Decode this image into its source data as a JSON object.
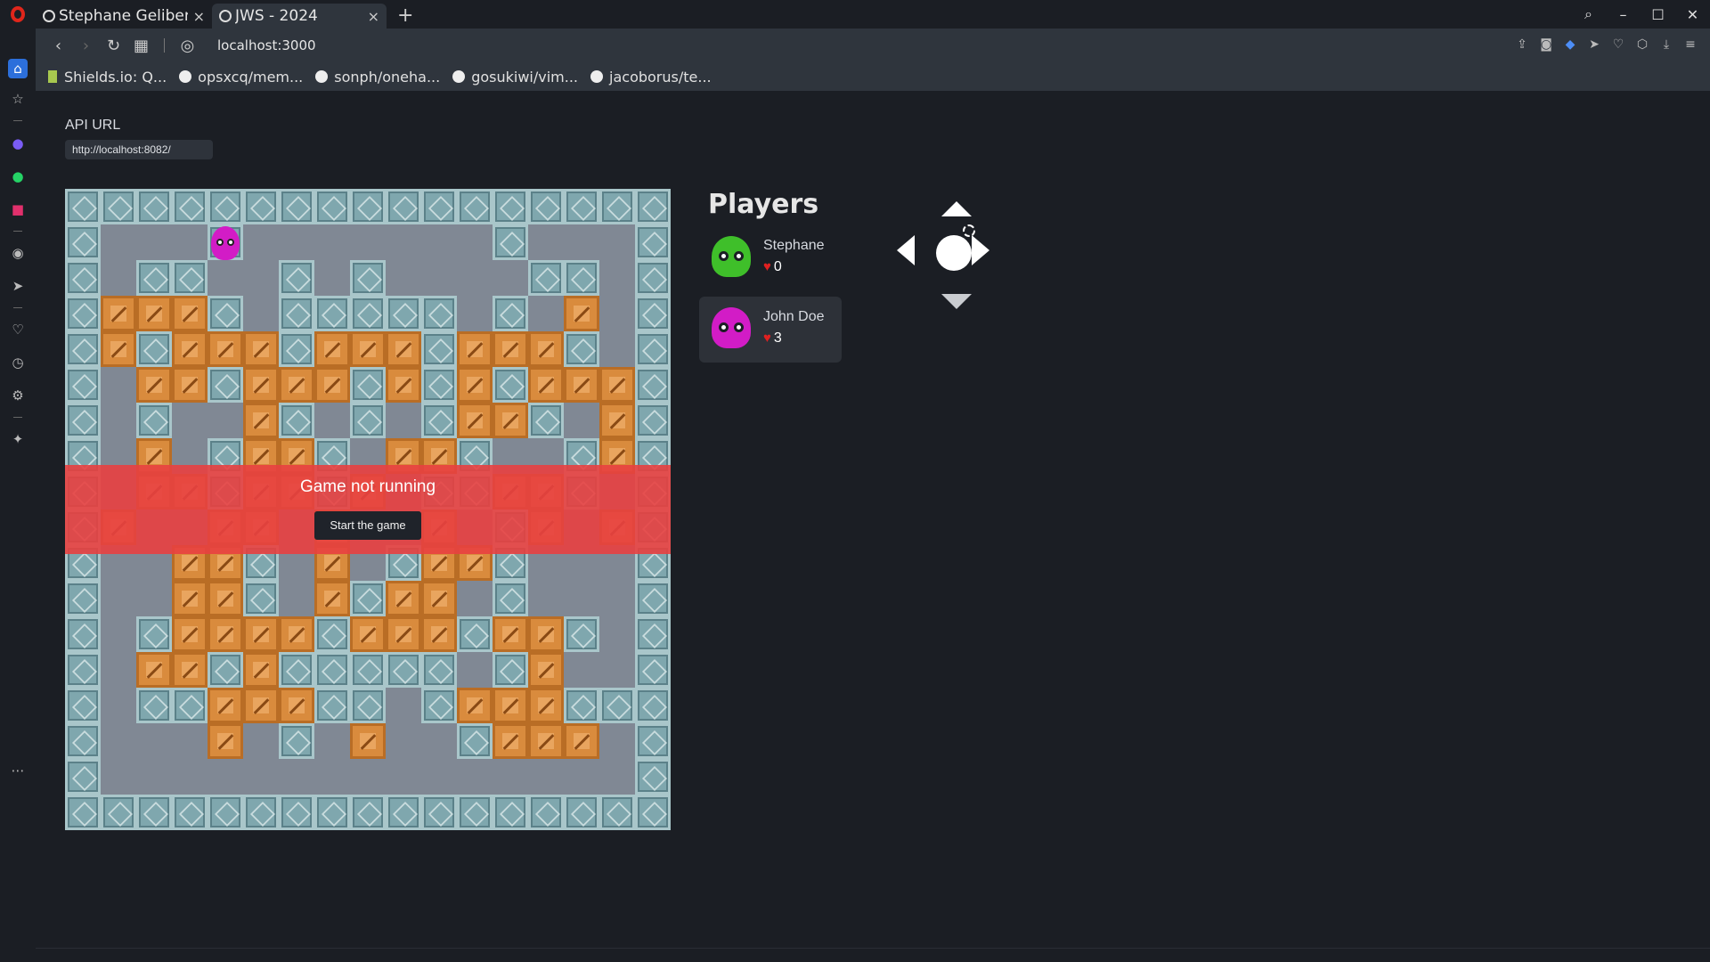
{
  "browser": {
    "tabs": [
      {
        "title": "Stephane Gelibert",
        "active": false
      },
      {
        "title": "JWS - 2024",
        "active": true
      }
    ],
    "url": "localhost:3000",
    "bookmarks": [
      "Shields.io: Q...",
      "opsxcq/mem...",
      "sonph/oneha...",
      "gosukiwi/vim...",
      "jacoborus/te..."
    ]
  },
  "app": {
    "api_label": "API URL",
    "api_value": "http://localhost:8082/",
    "players_title": "Players",
    "players": [
      {
        "name": "Stephane",
        "lives": "0",
        "color": "#3fbf2a"
      },
      {
        "name": "John Doe",
        "lives": "3",
        "color": "#d21cc6"
      }
    ],
    "overlay": {
      "message": "Game not running",
      "button": "Start the game"
    }
  },
  "colors": {
    "wall": "#7fa7ae",
    "crate": "#d98b3d",
    "floor": "#808894",
    "overlay": "#e84040"
  },
  "board": {
    "cols": 17,
    "rows": 18,
    "legend": {
      "W": "steel-block",
      "C": "wooden-crate",
      ".": "floor"
    },
    "grid": [
      "WWWWWWWWWWWWWWWWW",
      "W...W.......W...W",
      "W.WW..W.W....WW.W",
      "WCCCW.WWWWW.W.C.W",
      "WCWCCCWCCCWCCCW.W",
      "W.CCWCCCWCWCWCCCW",
      "W.W..CW.W.WCCW.CW",
      "W.C.WCCW.CCW..WCW",
      "W.CCWCCWC.WWCCW.W",
      "WC..CC.C..C.WC.CW",
      "W..CCW.C.WCCW...W",
      "W..CCW.CWCC.W...W",
      "W.WCCCCWCCCWCCW.W",
      "W.CCWCWWWWW.WC..W",
      "W.WWCCCWW.WCCCWWW",
      "W...C.W.C..WCCC.W",
      "W...............W",
      "WWWWWWWWWWWWWWWWW"
    ],
    "squid": {
      "col": 4,
      "row": 1,
      "color": "#d21cc6"
    }
  }
}
